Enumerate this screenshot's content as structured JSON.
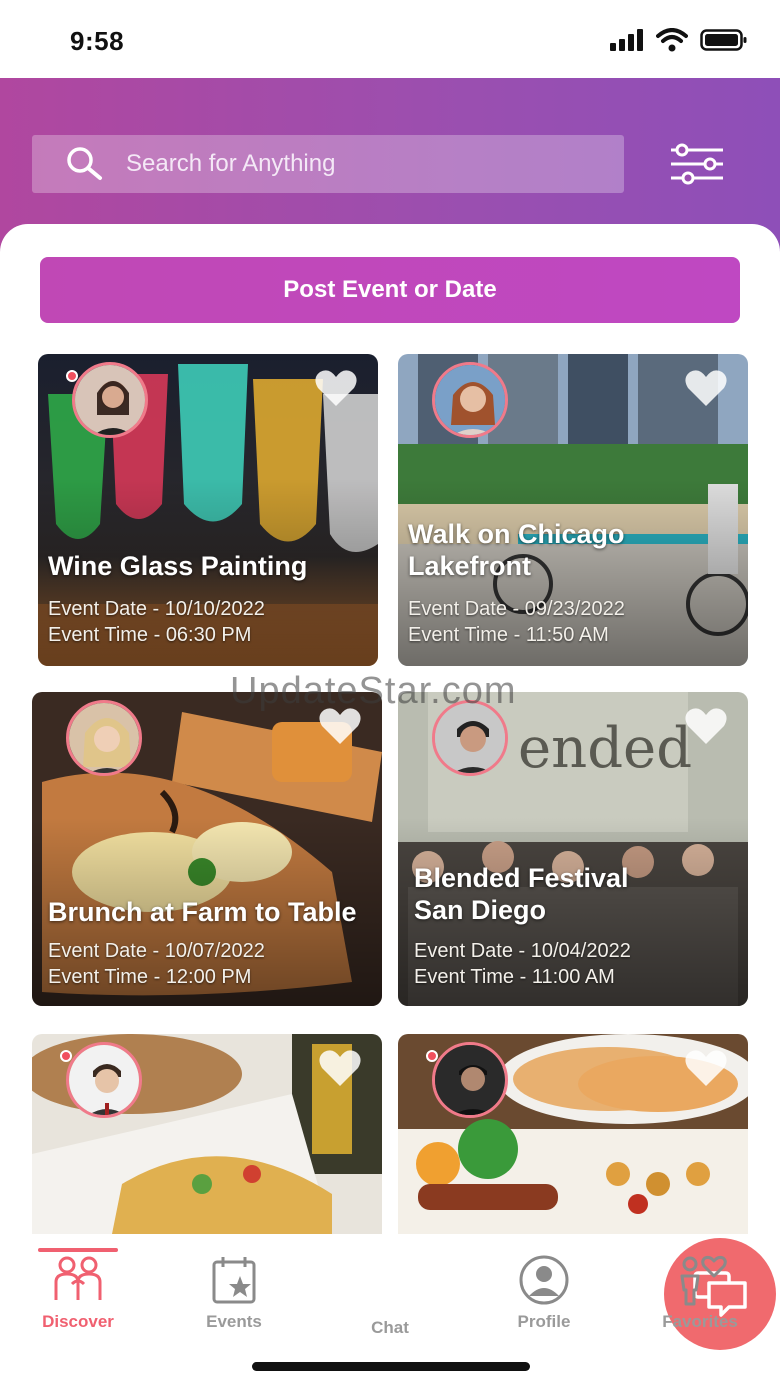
{
  "status_bar": {
    "time": "9:58"
  },
  "search": {
    "placeholder": "Search for Anything"
  },
  "post_button": {
    "label": "Post Event or Date"
  },
  "events": [
    {
      "title": "Wine Glass Painting",
      "date": "Event Date - 10/10/2022",
      "time": "Event Time - 06:30 PM"
    },
    {
      "title": "Walk on Chicago Lakefront",
      "date": "Event Date - 09/23/2022",
      "time": "Event Time - 11:50 AM"
    },
    {
      "title": "Brunch at Farm to Table",
      "date": "Event Date - 10/07/2022",
      "time": "Event Time - 12:00 PM"
    },
    {
      "title": "Blended Festival San Diego",
      "date": "Event Date - 10/04/2022",
      "time": "Event Time - 11:00 AM"
    },
    {
      "title": "",
      "date": "",
      "time": ""
    },
    {
      "title": "",
      "date": "",
      "time": ""
    }
  ],
  "card6_sign_text": "ended",
  "watermark": "UpdateStar.com",
  "tabs": [
    {
      "label": "Discover",
      "icon": "discover-icon",
      "active": true
    },
    {
      "label": "Events",
      "icon": "events-icon",
      "active": false
    },
    {
      "label": "Chat",
      "icon": "chat-icon",
      "active": false
    },
    {
      "label": "Profile",
      "icon": "profile-icon",
      "active": false
    },
    {
      "label": "Favorites",
      "icon": "favorites-icon",
      "active": false
    }
  ],
  "colors": {
    "accent": "#f06070",
    "header_start": "#b0479f",
    "header_end": "#8e4fb8",
    "button": "#c048b5"
  }
}
